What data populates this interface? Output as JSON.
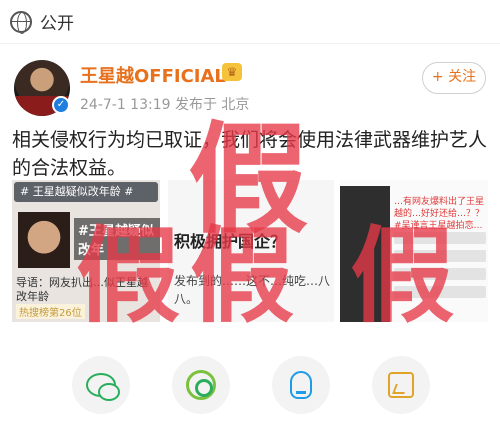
{
  "topbar": {
    "label": "公开",
    "icon": "globe-icon"
  },
  "post": {
    "author": "王星越OFFICIAL",
    "author_color": "#e8711d",
    "meta": "24-7-1 13:19  发布于 北京",
    "follow_label": "+ 关注",
    "text": "相关侵权行为均已取证，我们将会使用法律武器维护艺人的合法权益。"
  },
  "media": {
    "left": {
      "tag": "# 王星越疑似改年龄 #",
      "overlay": "#王星越疑似改年",
      "caption": "导语：网友扒出…似王星越改年龄",
      "hot": "热搜榜第26位"
    },
    "middle": {
      "title": "积极拥护国企？",
      "body": "发布到的……这不…纯吃…八八。"
    },
    "right": {
      "text": "…有网友爆料出了王星越的…好好还给…？？ #吴谨言王星越拍恋…"
    }
  },
  "watermark": {
    "top": "假",
    "row": "假假 假",
    "color": "#e53946"
  },
  "share": {
    "icons": [
      "wechat-icon",
      "moments-icon",
      "qq-icon",
      "save-image-icon"
    ]
  }
}
